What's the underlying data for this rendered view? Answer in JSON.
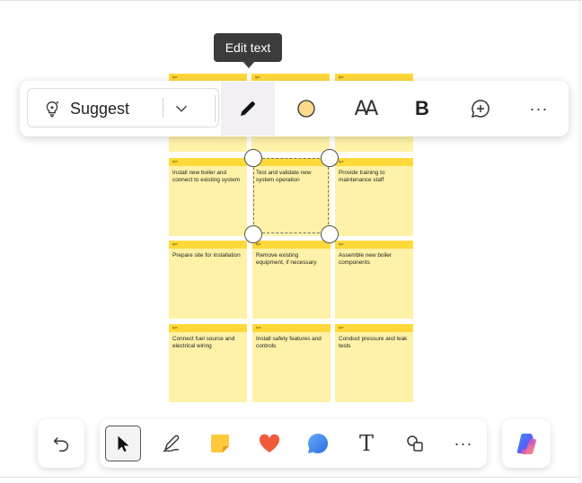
{
  "tooltip": {
    "text": "Edit text"
  },
  "toolbar": {
    "suggest_label": "Suggest",
    "icons": {
      "suggest": "lightbulb-sparkle-icon",
      "dropdown": "chevron-down-icon",
      "edit_text": "pencil-icon",
      "color": "color-circle-icon",
      "font_size": "font-size-icon",
      "bold": "bold-icon",
      "comment": "add-comment-icon",
      "more": "more-icon"
    },
    "color_swatch": "#fdd98a",
    "aa_glyph": "AA",
    "bold_glyph": "B",
    "more_glyph": "···"
  },
  "notes": [
    {
      "tag": "tpe",
      "text": ""
    },
    {
      "tag": "tpe",
      "text": ""
    },
    {
      "tag": "tpe",
      "text": ""
    },
    {
      "tag": "tpe",
      "text": "Install new boiler and connect to existing system"
    },
    {
      "tag": "tpe",
      "text": "Test and validate new system operation"
    },
    {
      "tag": "tpe",
      "text": "Provide training to maintenance staff"
    },
    {
      "tag": "tpe",
      "text": "Prepare site for installation"
    },
    {
      "tag": "tpe",
      "text": "Remove existing equipment, if necessary"
    },
    {
      "tag": "tpe",
      "text": "Assemble new boiler components"
    },
    {
      "tag": "tpe",
      "text": "Connect fuel source and electrical wiring"
    },
    {
      "tag": "tpe",
      "text": "Install safety features and controls"
    },
    {
      "tag": "tpe",
      "text": "Conduct pressure and leak tests"
    }
  ],
  "bottom_toolbar": {
    "undo": "undo-icon",
    "select": "select-pointer-icon",
    "pen": "pen-icon",
    "sticky_note": "sticky-note-icon",
    "reaction": "heart-icon",
    "comment": "comment-bubble-icon",
    "text": "text-icon",
    "text_glyph": "T",
    "shapes": "shapes-icon",
    "more": "more-icon",
    "more_glyph": "···",
    "copilot": "copilot-icon"
  },
  "colors": {
    "note_body": "#fff2a8",
    "note_strip": "#ffd93a",
    "heart": "#f05a3a",
    "bubble": "#3b82f6"
  }
}
